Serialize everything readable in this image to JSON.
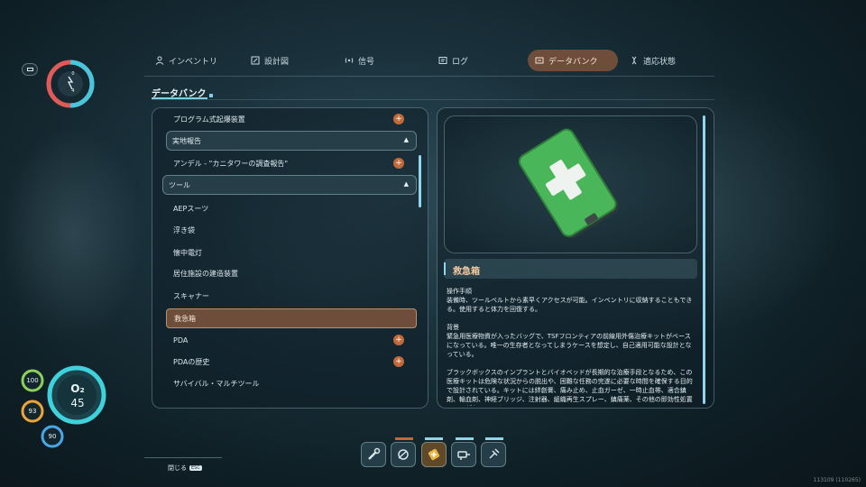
{
  "tabs": [
    {
      "label": "インベントリ",
      "icon": "person-icon",
      "active": false
    },
    {
      "label": "設計図",
      "icon": "blueprint-icon",
      "active": false
    },
    {
      "label": "信号",
      "icon": "signal-icon",
      "active": false
    },
    {
      "label": "ログ",
      "icon": "log-icon",
      "active": false
    },
    {
      "label": "データバンク",
      "icon": "databank-icon",
      "active": true
    },
    {
      "label": "適応状態",
      "icon": "dna-icon",
      "active": false
    }
  ],
  "section_title": "データバンク",
  "list": {
    "rows": [
      {
        "label": "プログラム式起爆装置",
        "kind": "item",
        "plus": true
      },
      {
        "label": "実地報告",
        "kind": "header"
      },
      {
        "label": "アンデル - \"カニタワーの調査報告\"",
        "kind": "item",
        "plus": true
      },
      {
        "label": "ツール",
        "kind": "header"
      },
      {
        "label": "AEPスーツ",
        "kind": "item"
      },
      {
        "label": "浮き袋",
        "kind": "item"
      },
      {
        "label": "懐中電灯",
        "kind": "item"
      },
      {
        "label": "居住施設の建造装置",
        "kind": "item"
      },
      {
        "label": "スキャナー",
        "kind": "item"
      },
      {
        "label": "救急箱",
        "kind": "selected"
      },
      {
        "label": "PDA",
        "kind": "item",
        "plus": true
      },
      {
        "label": "PDAの歴史",
        "kind": "item",
        "plus": true
      },
      {
        "label": "サバイバル・マルチツール",
        "kind": "item"
      }
    ]
  },
  "detail": {
    "title": "救急箱",
    "paragraphs": [
      "操作手順\n装備時、ツールベルトから素早くアクセスが可能。インベントリに収納することもできる。使用すると体力を回復する。",
      "背景\n緊急用医療物資が入ったバッグで、TSFフロンティアの前線用外傷治療キットがベースになっている。唯一の生存者となってしまうケースを想定し、自己適用可能な設計となっている。",
      "ブラックボックスのインプラントとバイオベッドが長期的な治療手段となるため、この医療キットは危険な状況からの脱出や、困難な任務の完遂に必要な時間を確保する目的で設計されている。キットには絆創膏、痛み止め、止血ガーゼ、一時止血帯、適合鎮剤、輸血剤、神経ブリッジ、注射器、組織再生スプレー、鎮痛薬、その他の即効性処置ツールが入っている。"
    ]
  },
  "hud": {
    "o2_label": "O₂",
    "o2_value": "45",
    "stats": [
      "100",
      "93",
      "90"
    ],
    "top_gauge": [
      "0",
      "4"
    ]
  },
  "hotbar": {
    "slots": [
      "wrench-icon",
      "scanner-icon",
      "medkit-icon",
      "drill-icon",
      "plug-icon"
    ]
  },
  "close_label": "閉じる",
  "close_key": "ESC",
  "build_id": "113109 (110265)",
  "colors": {
    "accent": "#8fd6ea",
    "active_tab": "#6e4e3a",
    "plus": "#c2693a"
  }
}
